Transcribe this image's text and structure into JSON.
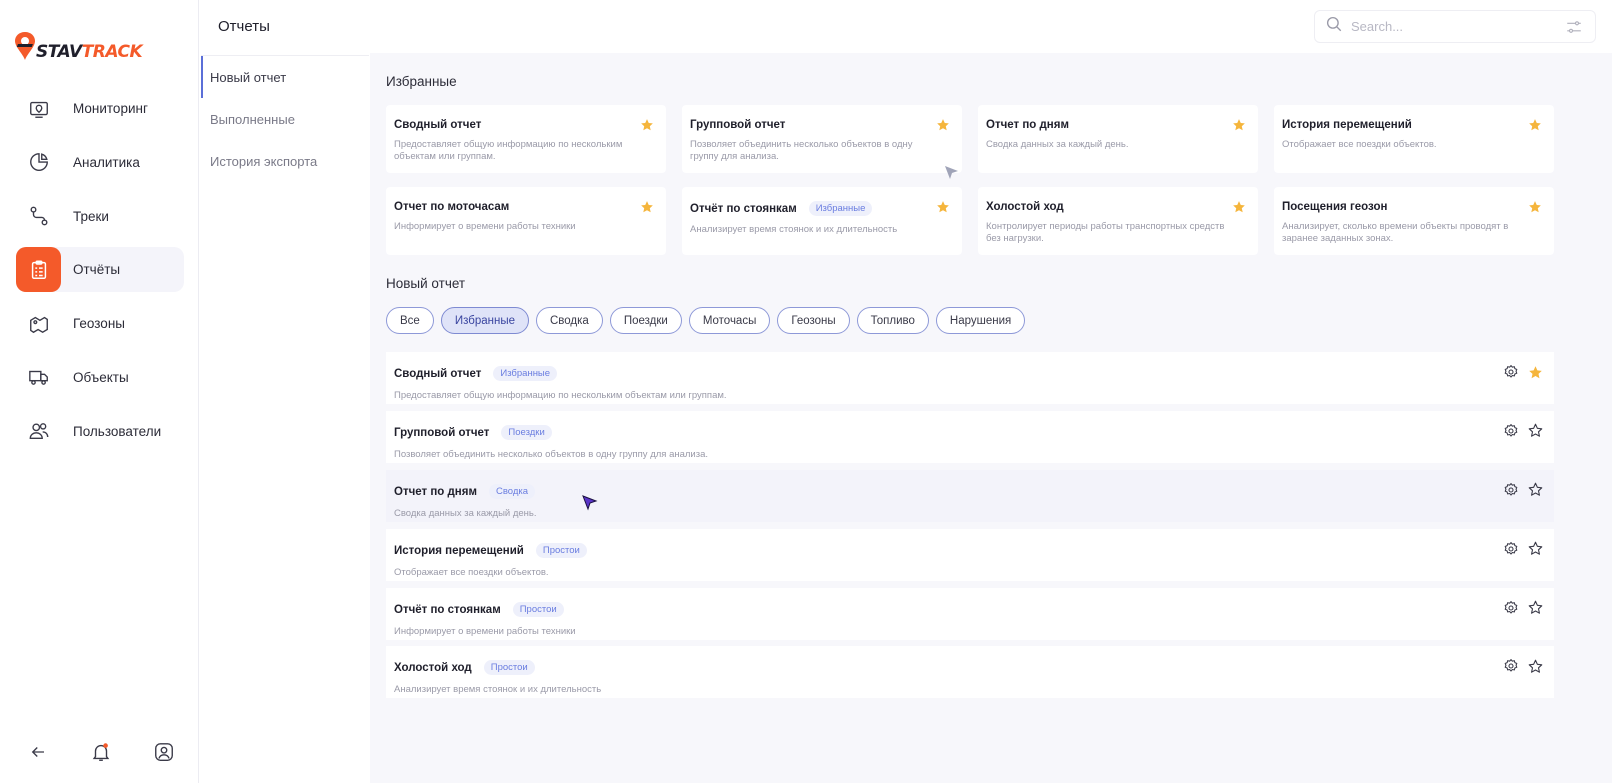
{
  "app": {
    "logo_stav": "STAV",
    "logo_track": "TRACK",
    "page_title": "Отчеты",
    "brand_color": "#f45a2a",
    "accent_color": "#5b6fd8"
  },
  "sidebar": {
    "items": [
      {
        "label": "Мониторинг",
        "icon": "monitor-pin-icon"
      },
      {
        "label": "Аналитика",
        "icon": "pie-chart-icon"
      },
      {
        "label": "Треки",
        "icon": "route-icon"
      },
      {
        "label": "Отчёты",
        "icon": "clipboard-report-icon",
        "active": true
      },
      {
        "label": "Геозоны",
        "icon": "map-zone-icon"
      },
      {
        "label": "Объекты",
        "icon": "truck-icon"
      },
      {
        "label": "Пользователи",
        "icon": "users-icon"
      }
    ]
  },
  "subnav": {
    "items": [
      "Новый отчет",
      "Выполненные",
      "История экспорта"
    ]
  },
  "search": {
    "placeholder": "Search..."
  },
  "favorites": {
    "title": "Избранные",
    "cards": [
      {
        "title": "Сводный отчет",
        "desc": "Предоставляет общую информацию по нескольким объектам или группам."
      },
      {
        "title": "Групповой отчет",
        "desc": "Позволяет объединить несколько объектов в одну группу для анализа."
      },
      {
        "title": "Отчет по дням",
        "desc": "Сводка данных за каждый день."
      },
      {
        "title": "История перемещений",
        "desc": "Отображает все поездки объектов."
      },
      {
        "title": "Отчет по моточасам",
        "desc": "Информирует о времени работы техники"
      },
      {
        "title": "Отчёт по стоянкам",
        "badge": "Избранные",
        "desc": "Анализирует время стоянок и их длительность"
      },
      {
        "title": "Холостой ход",
        "desc": "Контролирует периоды работы транспортных средств без нагрузки."
      },
      {
        "title": "Посещения геозон",
        "desc": "Анализирует, сколько времени объекты проводят в заранее заданных зонах."
      }
    ]
  },
  "new_report": {
    "title": "Новый отчет",
    "chips": [
      {
        "label": "Все"
      },
      {
        "label": "Избранные",
        "active": true
      },
      {
        "label": "Сводка"
      },
      {
        "label": "Поездки"
      },
      {
        "label": "Моточасы"
      },
      {
        "label": "Геозоны"
      },
      {
        "label": "Топливо"
      },
      {
        "label": "Нарушения"
      }
    ],
    "rows": [
      {
        "title": "Сводный отчет",
        "badge": "Избранные",
        "desc": "Предоставляет общую информацию по нескольким объектам или группам.",
        "favorite": true
      },
      {
        "title": "Групповой отчет",
        "badge": "Поездки",
        "desc": "Позволяет объединить несколько объектов в одну группу для анализа.",
        "favorite": false
      },
      {
        "title": "Отчет по дням",
        "badge": "Сводка",
        "desc": "Сводка данных за каждый день.",
        "favorite": false
      },
      {
        "title": "История перемещений",
        "badge": "Простои",
        "desc": "Отображает все поездки объектов.",
        "favorite": false
      },
      {
        "title": "Отчёт по стоянкам",
        "badge": "Простои",
        "desc": "Информирует о времени работы техники",
        "favorite": false
      },
      {
        "title": "Холостой ход",
        "badge": "Простои",
        "desc": "Анализирует время стоянок и их длительность",
        "favorite": false
      }
    ]
  }
}
